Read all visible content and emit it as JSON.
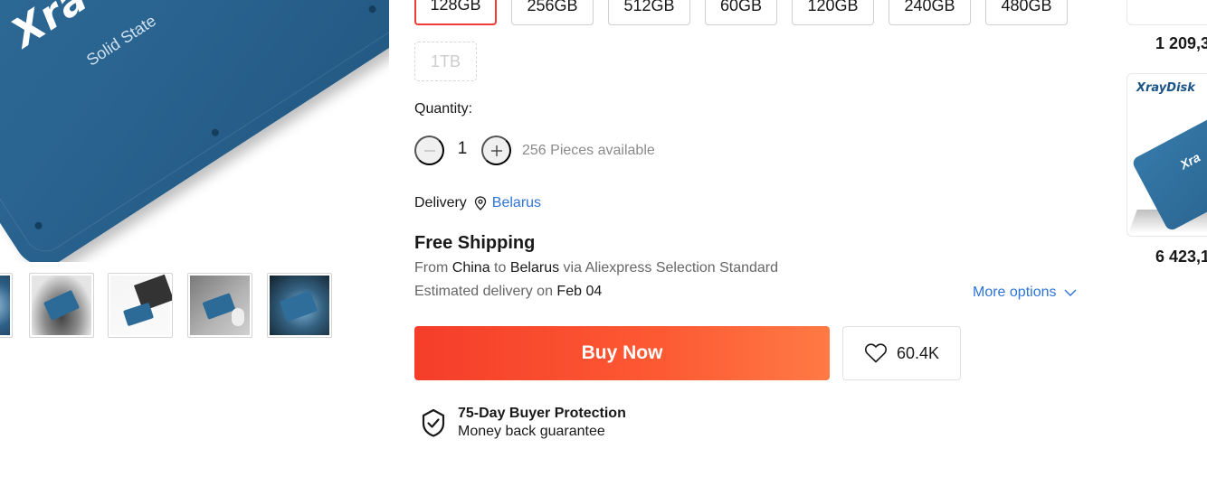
{
  "gallery": {
    "main_image": {
      "brand_text": "Xra",
      "subtitle_text": "Solid State"
    },
    "thumbnails": [
      {
        "name": "thumb-0"
      },
      {
        "name": "thumb-1"
      },
      {
        "name": "thumb-2"
      },
      {
        "name": "thumb-3"
      },
      {
        "name": "thumb-4"
      }
    ]
  },
  "capacity": {
    "options": [
      "128GB",
      "256GB",
      "512GB",
      "60GB",
      "120GB",
      "240GB",
      "480GB",
      "1TB"
    ],
    "selected": "128GB",
    "disabled": [
      "1TB"
    ]
  },
  "quantity": {
    "label": "Quantity:",
    "value": "1",
    "minus_icon": "minus-icon",
    "plus_icon": "plus-icon",
    "available": "256 Pieces available"
  },
  "delivery": {
    "label": "Delivery",
    "country": "Belarus",
    "icon": "location-pin-icon"
  },
  "shipping": {
    "title": "Free Shipping",
    "route_from_prefix": "From",
    "route_origin": "China",
    "route_to": "to",
    "route_dest": "Belarus",
    "route_via": "via Aliexpress Selection Standard",
    "eta_prefix": "Estimated delivery on",
    "eta_date": "Feb 04",
    "more_options": "More options"
  },
  "actions": {
    "buy_now": "Buy Now",
    "wishlist_count": "60.4K",
    "wishlist_icon": "heart-icon"
  },
  "protection": {
    "icon": "shield-check-icon",
    "title": "75-Day Buyer Protection",
    "subtitle": "Money back guarantee"
  },
  "recommendations": [
    {
      "price": "1 209,3"
    },
    {
      "logo": "XrayDisk",
      "image_text": "Xra",
      "price": "6 423,1"
    }
  ],
  "colors": {
    "accent_red": "#f03c32",
    "buy_gradient_start": "#f53d2a",
    "buy_gradient_end": "#ff7a45",
    "link_blue": "#2e74d8",
    "ssd_blue": "#2a6490"
  }
}
